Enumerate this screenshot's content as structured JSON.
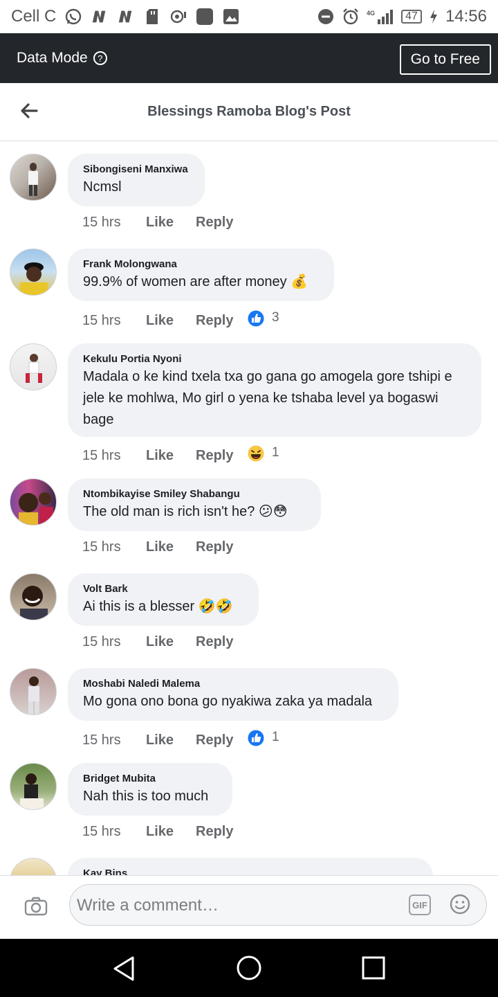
{
  "status_bar": {
    "carrier": "Cell C",
    "network": "4G",
    "battery": "47",
    "time": "14:56",
    "icons": [
      "whatsapp-icon",
      "n-icon",
      "n-icon",
      "sd-card-icon",
      "camera-icon",
      "square-app-icon",
      "gallery-icon",
      "dnd-icon",
      "alarm-icon",
      "signal-icon",
      "charging-icon"
    ]
  },
  "data_bar": {
    "mode_label": "Data Mode",
    "help_icon": "?",
    "go_free_label": "Go to Free",
    "background": "#23272b"
  },
  "header": {
    "title": "Blessings Ramoba Blog's Post",
    "back_icon": "arrow-left-icon"
  },
  "comments": [
    {
      "name": "Sibongiseni Manxiwa",
      "text": "Ncmsl",
      "time": "15 hrs",
      "like": "Like",
      "reply": "Reply",
      "reaction": null,
      "count": null
    },
    {
      "name": "Frank Molongwana",
      "text": "99.9% of women are after money 💰",
      "time": "15 hrs",
      "like": "Like",
      "reply": "Reply",
      "reaction": "like",
      "count": "3"
    },
    {
      "name": "Kekulu Portia Nyoni",
      "text": "Madala o ke kind txela txa go gana go amogela gore tshipi e jele ke mohlwa, Mo girl o yena ke tshaba level ya bogaswi bage",
      "time": "15 hrs",
      "like": "Like",
      "reply": "Reply",
      "reaction": "haha",
      "count": "1"
    },
    {
      "name": "Ntombikayise Smiley Shabangu",
      "text": "The old man is rich isn't he? 😕😳",
      "time": "15 hrs",
      "like": "Like",
      "reply": "Reply",
      "reaction": null,
      "count": null
    },
    {
      "name": "Volt Bark",
      "text": "Ai this is a blesser 🤣🤣",
      "time": "15 hrs",
      "like": "Like",
      "reply": "Reply",
      "reaction": null,
      "count": null
    },
    {
      "name": "Moshabi Naledi Malema",
      "text": "Mo gona ono bona go nyakiwa zaka ya madala",
      "time": "15 hrs",
      "like": "Like",
      "reply": "Reply",
      "reaction": "like",
      "count": "1"
    },
    {
      "name": "Bridget Mubita",
      "text": "Nah this is too much",
      "time": "15 hrs",
      "like": "Like",
      "reply": "Reply",
      "reaction": null,
      "count": null
    },
    {
      "name": "Kay Bins",
      "text": "",
      "time": "",
      "like": "",
      "reply": "",
      "reaction": null,
      "count": null
    }
  ],
  "composer": {
    "placeholder": "Write a comment…",
    "gif_label": "GIF",
    "camera_icon": "camera-icon",
    "emoji_icon": "smile-icon"
  },
  "nav": {
    "back_icon": "triangle-back-icon",
    "home_icon": "circle-home-icon",
    "recent_icon": "square-recent-icon"
  },
  "colors": {
    "like_blue": "#1877f2",
    "meta_gray": "#65676b",
    "bubble_bg": "#f0f2f5"
  }
}
